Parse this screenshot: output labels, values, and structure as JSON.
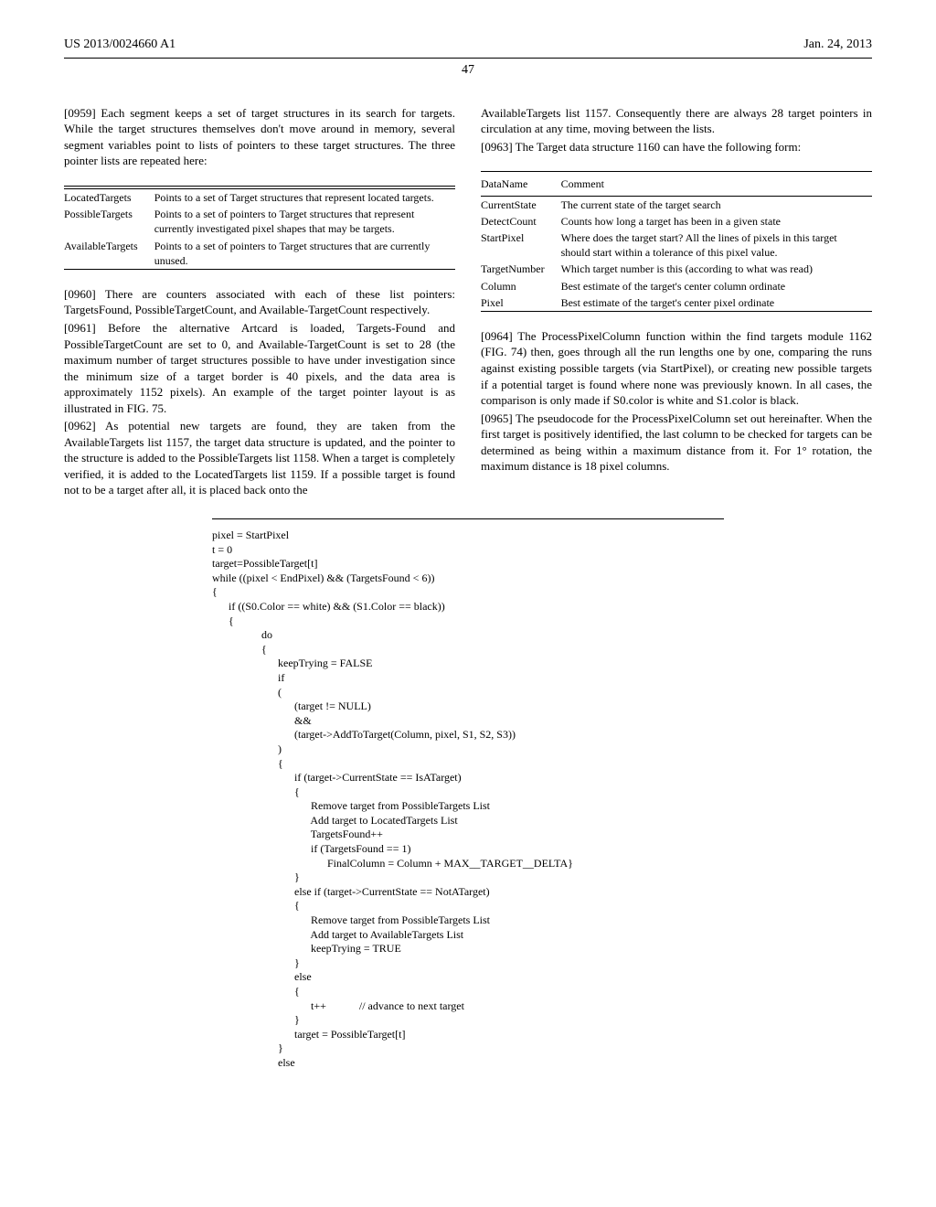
{
  "header": {
    "pub_number": "US 2013/0024660 A1",
    "pub_date": "Jan. 24, 2013",
    "page_number": "47"
  },
  "left": {
    "p0959": "[0959]   Each segment keeps a set of target structures in its search for targets. While the target structures themselves don't move around in memory, several segment variables point to lists of pointers to these target structures. The three pointer lists are repeated here:",
    "table1": [
      {
        "name": "LocatedTargets",
        "desc": "Points to a set of Target structures that represent located targets."
      },
      {
        "name": "PossibleTargets",
        "desc": "Points to a set of pointers to Target structures that represent currently investigated pixel shapes that may be targets."
      },
      {
        "name": "AvailableTargets",
        "desc": "Points to a set of pointers to Target structures that are currently unused."
      }
    ],
    "p0960": "[0960]   There are counters associated with each of these list pointers: TargetsFound, PossibleTargetCount, and Available-TargetCount respectively.",
    "p0961": "[0961]   Before the alternative Artcard is loaded, Targets-Found and PossibleTargetCount are set to 0, and Available-TargetCount is set to 28 (the maximum number of target structures possible to have under investigation since the minimum size of a target border is 40 pixels, and the data area is approximately 1152 pixels). An example of the target pointer layout is as illustrated in FIG. 75.",
    "p0962": "[0962]   As potential new targets are found, they are taken from the AvailableTargets list 1157, the target data structure is updated, and the pointer to the structure is added to the PossibleTargets list 1158. When a target is completely verified, it is added to the LocatedTargets list 1159. If a possible target is found not to be a target after all, it is placed back onto the"
  },
  "right": {
    "cont": "AvailableTargets list 1157. Consequently there are always 28 target pointers in circulation at any time, moving between the lists.",
    "p0963": "[0963]   The Target data structure 1160 can have the following form:",
    "table2_header": {
      "c1": "DataName",
      "c2": "Comment"
    },
    "table2": [
      {
        "name": "CurrentState",
        "desc": "The current state of the target search"
      },
      {
        "name": "DetectCount",
        "desc": "Counts how long a target has been in a given state"
      },
      {
        "name": "StartPixel",
        "desc": "Where does the target start? All the lines of pixels in this target should start within a tolerance of this pixel value."
      },
      {
        "name": "TargetNumber",
        "desc": "Which target number is this (according to what was read)"
      },
      {
        "name": "Column",
        "desc": "Best estimate of the target's center column ordinate"
      },
      {
        "name": "Pixel",
        "desc": "Best estimate of the target's center pixel ordinate"
      }
    ],
    "p0964": "[0964]   The ProcessPixelColumn function within the find targets module 1162 (FIG. 74) then, goes through all the run lengths one by one, comparing the runs against existing possible targets (via StartPixel), or creating new possible targets if a potential target is found where none was previously known. In all cases, the comparison is only made if S0.color is white and S1.color is black.",
    "p0965": "[0965]   The pseudocode for the ProcessPixelColumn set out hereinafter. When the first target is positively identified, the last column to be checked for targets can be determined as being within a maximum distance from it. For 1° rotation, the maximum distance is 18 pixel columns."
  },
  "code": "pixel = StartPixel\nt = 0\ntarget=PossibleTarget[t]\nwhile ((pixel < EndPixel) && (TargetsFound < 6))\n{\n      if ((S0.Color == white) && (S1.Color == black))\n      {\n                  do\n                  {\n                        keepTrying = FALSE\n                        if\n                        (\n                              (target != NULL)\n                              &&\n                              (target->AddToTarget(Column, pixel, S1, S2, S3))\n                        )\n                        {\n                              if (target->CurrentState == IsATarget)\n                              {\n                                    Remove target from PossibleTargets List\n                                    Add target to LocatedTargets List\n                                    TargetsFound++\n                                    if (TargetsFound == 1)\n                                          FinalColumn = Column + MAX__TARGET__DELTA}\n                              }\n                              else if (target->CurrentState == NotATarget)\n                              {\n                                    Remove target from PossibleTargets List\n                                    Add target to AvailableTargets List\n                                    keepTrying = TRUE\n                              }\n                              else\n                              {\n                                    t++            // advance to next target\n                              }\n                              target = PossibleTarget[t]\n                        }\n                        else"
}
